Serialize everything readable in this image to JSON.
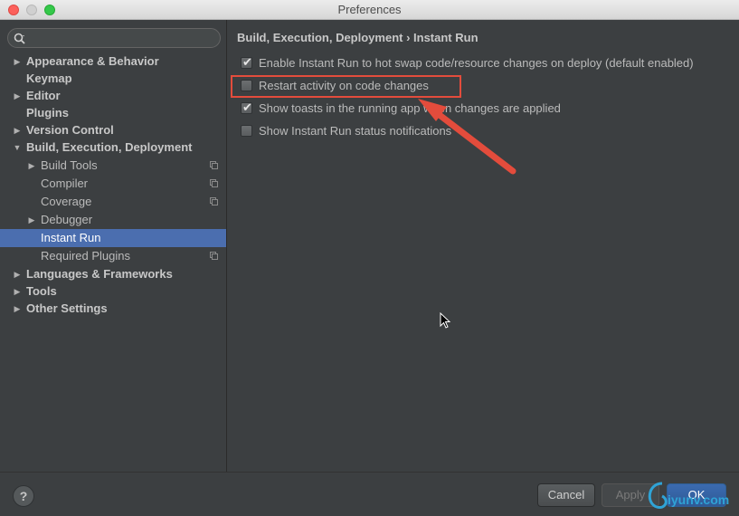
{
  "window": {
    "title": "Preferences"
  },
  "search": {
    "placeholder": ""
  },
  "sidebar": {
    "items": [
      {
        "label": "Appearance & Behavior",
        "arrow": "▶",
        "bold": true
      },
      {
        "label": "Keymap",
        "arrow": "",
        "bold": true
      },
      {
        "label": "Editor",
        "arrow": "▶",
        "bold": true
      },
      {
        "label": "Plugins",
        "arrow": "",
        "bold": true
      },
      {
        "label": "Version Control",
        "arrow": "▶",
        "bold": true
      },
      {
        "label": "Build, Execution, Deployment",
        "arrow": "▼",
        "bold": true
      },
      {
        "label": "Build Tools",
        "arrow": "▶",
        "bold": false,
        "copy": true
      },
      {
        "label": "Compiler",
        "arrow": "",
        "bold": false,
        "copy": true
      },
      {
        "label": "Coverage",
        "arrow": "",
        "bold": false,
        "copy": true
      },
      {
        "label": "Debugger",
        "arrow": "▶",
        "bold": false
      },
      {
        "label": "Instant Run",
        "arrow": "",
        "bold": false,
        "selected": true
      },
      {
        "label": "Required Plugins",
        "arrow": "",
        "bold": false,
        "copy": true
      },
      {
        "label": "Languages & Frameworks",
        "arrow": "▶",
        "bold": true
      },
      {
        "label": "Tools",
        "arrow": "▶",
        "bold": true
      },
      {
        "label": "Other Settings",
        "arrow": "▶",
        "bold": true
      }
    ]
  },
  "content": {
    "breadcrumb": "Build, Execution, Deployment › Instant Run",
    "options": [
      {
        "label": "Enable Instant Run to hot swap code/resource changes on deploy (default enabled)",
        "checked": true
      },
      {
        "label": "Restart activity on code changes",
        "checked": false
      },
      {
        "label": "Show toasts in the running app when changes are applied",
        "checked": true
      },
      {
        "label": "Show Instant Run status notifications",
        "checked": false
      }
    ]
  },
  "footer": {
    "help_label": "?",
    "cancel_label": "Cancel",
    "apply_label": "Apply",
    "ok_label": "OK"
  },
  "watermark": {
    "text": "iyunv.com"
  },
  "colors": {
    "selection": "#4b6eaf",
    "annotation": "#e34c3c",
    "ok_button": "#3b6bb0"
  }
}
